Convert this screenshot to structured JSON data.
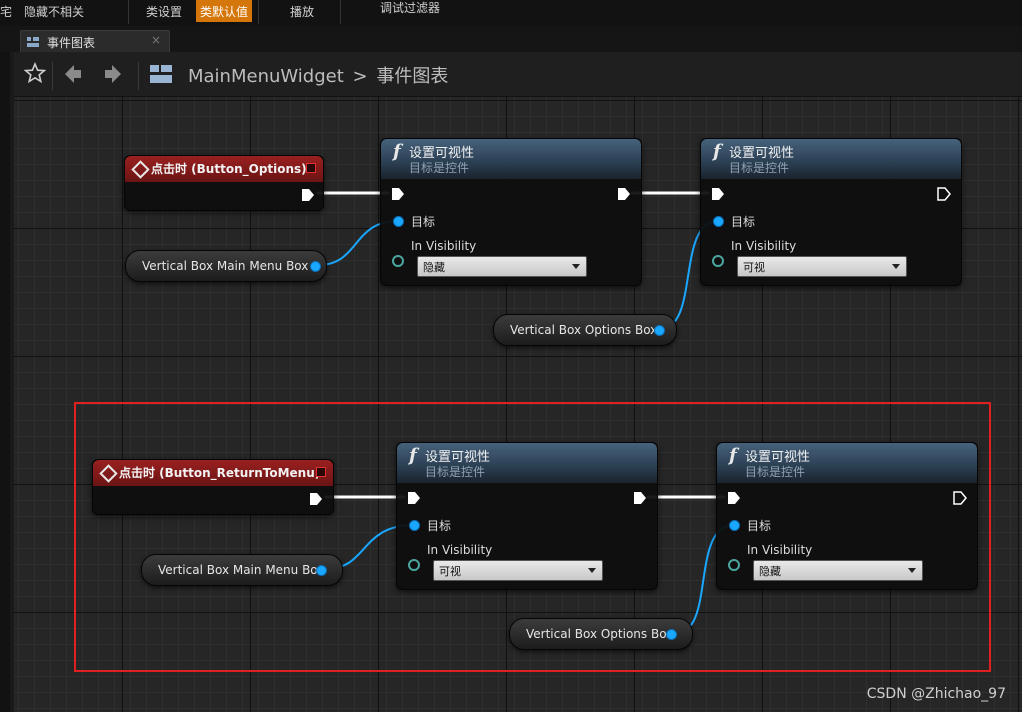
{
  "toolbar": {
    "hide_unrelated": "隐藏不相关",
    "class_settings": "类设置",
    "class_defaults": "类默认值",
    "play": "播放",
    "debug_filter": "调试过滤器"
  },
  "tab": {
    "label": "事件图表",
    "close": "×"
  },
  "breadcrumb": {
    "widget": "MainMenuWidget",
    "separator": ">",
    "graph": "事件图表"
  },
  "nodes": {
    "event_options": {
      "title": "点击时 (Button_Options)"
    },
    "event_return": {
      "title": "点击时 (Button_ReturnToMenu)"
    },
    "setvis_1": {
      "title": "设置可视性",
      "subtitle": "目标是控件",
      "target": "目标",
      "in_visibility": "In Visibility",
      "value": "隐藏"
    },
    "setvis_2": {
      "title": "设置可视性",
      "subtitle": "目标是控件",
      "target": "目标",
      "in_visibility": "In Visibility",
      "value": "可视"
    },
    "setvis_3": {
      "title": "设置可视性",
      "subtitle": "目标是控件",
      "target": "目标",
      "in_visibility": "In Visibility",
      "value": "可视"
    },
    "setvis_4": {
      "title": "设置可视性",
      "subtitle": "目标是控件",
      "target": "目标",
      "in_visibility": "In Visibility",
      "value": "隐藏"
    },
    "var_main_1": {
      "label": "Vertical Box Main Menu Box"
    },
    "var_options_1": {
      "label": "Vertical Box Options Box"
    },
    "var_main_2": {
      "label": "Vertical Box Main Menu Box"
    },
    "var_options_2": {
      "label": "Vertical Box Options Box"
    }
  },
  "watermark": "CSDN @Zhichao_97",
  "colors": {
    "exec_wire": "#ffffff",
    "object_wire": "#19a7ff",
    "highlight": "#e02020",
    "active_tab": "#d4760a"
  }
}
